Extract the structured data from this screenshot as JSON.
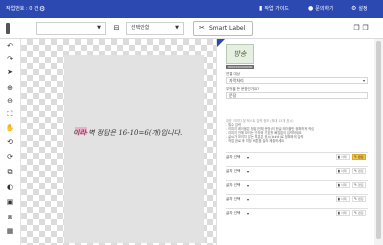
{
  "topbar": {
    "title": "작업번호 : 0 건",
    "buttons": [
      {
        "label": "작업 가이드",
        "icon": "book-icon"
      },
      {
        "label": "문의하기",
        "icon": "help-icon"
      },
      {
        "label": "설정",
        "icon": "gear-icon"
      }
    ]
  },
  "toolbar": {
    "select1": "",
    "select2": "선택안함",
    "smart_label": "Smart Label"
  },
  "canvas": {
    "handwriting": "이라·벽 정답은 16-10=6(개)입니다."
  },
  "panel": {
    "thumb_text": "방송",
    "thumb_caption": "0000000000000",
    "field1_label": "연결 대상",
    "field1_value": "자막처리",
    "field2_label": "무엇을 쓴 문장인가요?",
    "field2_value": "문장",
    "desc_header": "대표 이미지 및 텍스트 입력 정보 (최대 15개 표시)",
    "desc_sub": "- 필수 입력",
    "desc_lines": [
      "- 이미지 레이블은 정답(전체 문장)의 한글 레이블만 정확하게 작성",
      "- 이미지 안에 보이는 숫자와 기호를 빠짐없이 입력하세요",
      "- 글씨가 보이지 않는 부분은 표시(###)로 정확하게 입력",
      "- 작업 완료 후 저장 버튼을 눌러 제출하세요"
    ],
    "rows": [
      {
        "label": "글자 선택",
        "delete": "삭제",
        "edit": "편집",
        "active": true
      },
      {
        "label": "글자 선택",
        "delete": "삭제",
        "edit": "편집",
        "active": false
      },
      {
        "label": "글자 선택",
        "delete": "삭제",
        "edit": "편집",
        "active": false
      },
      {
        "label": "글자 선택",
        "delete": "삭제",
        "edit": "편집",
        "active": false
      },
      {
        "label": "글자 선택",
        "delete": "삭제",
        "edit": "편집",
        "active": false
      }
    ]
  },
  "colors": {
    "topbar": "#2b49b0",
    "accent": "#f2c34a",
    "highlight": "#f0a6c4"
  }
}
